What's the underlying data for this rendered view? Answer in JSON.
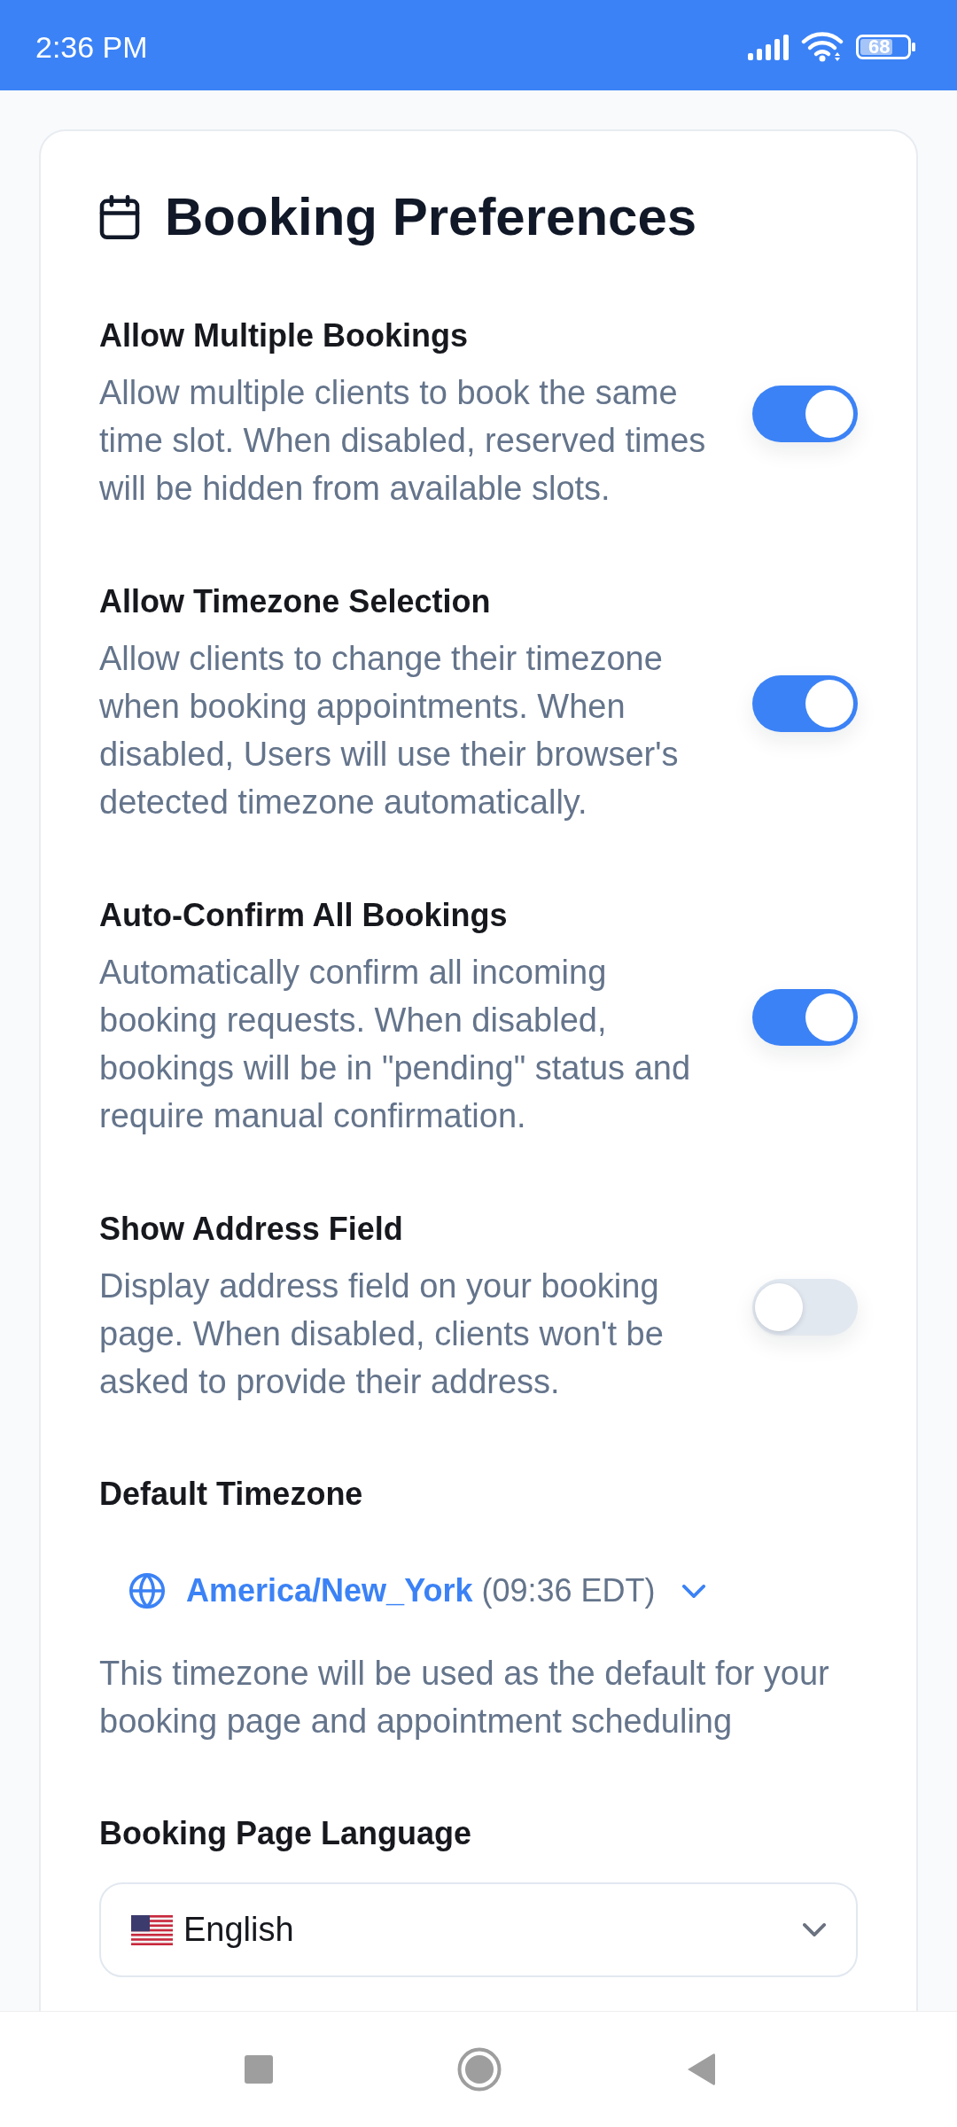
{
  "status_bar": {
    "time": "2:36 PM",
    "battery": "68"
  },
  "card": {
    "title": "Booking Preferences",
    "settings": [
      {
        "label": "Allow Multiple Bookings",
        "description": "Allow multiple clients to book the same time slot. When disabled, reserved times will be hidden from available slots.",
        "on": true
      },
      {
        "label": "Allow Timezone Selection",
        "description": "Allow clients to change their timezone when booking appointments. When disabled, Users will use their browser's detected timezone automatically.",
        "on": true
      },
      {
        "label": "Auto-Confirm All Bookings",
        "description": "Automatically confirm all incoming booking requests. When disabled, bookings will be in \"pending\" status and require manual confirmation.",
        "on": true
      },
      {
        "label": "Show Address Field",
        "description": "Display address field on your booking page. When disabled, clients won't be asked to provide their address.",
        "on": false
      }
    ],
    "timezone": {
      "label": "Default Timezone",
      "zone": "America/New_York",
      "time": "(09:36 EDT)",
      "help": "This timezone will be used as the default for your booking page and appointment scheduling"
    },
    "language": {
      "label": "Booking Page Language",
      "value": "English"
    }
  }
}
